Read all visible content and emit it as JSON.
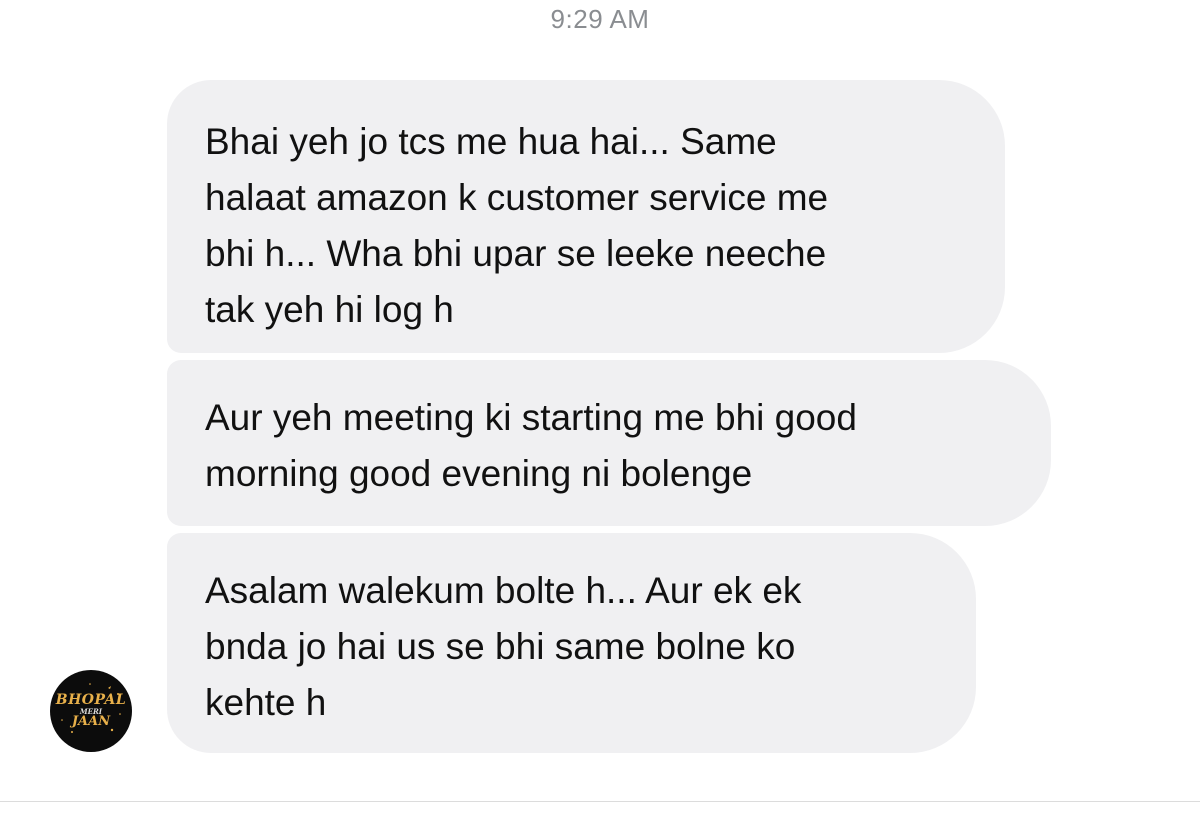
{
  "conversation": {
    "timestamp": "9:29 AM",
    "messages": [
      {
        "text": "Bhai yeh jo tcs me hua hai... Same\nhalaat amazon k customer service me\nbhi h... Wha bhi upar se leeke neeche\ntak yeh hi log h"
      },
      {
        "text": "Aur yeh meeting ki starting me bhi good\nmorning good evening ni bolenge"
      },
      {
        "text": "Asalam walekum bolte h... Aur ek ek\nbnda jo hai us se bhi same bolne ko\nkehte h"
      }
    ],
    "sender_avatar": {
      "line1": "BHOPAL",
      "line2": "MERI",
      "line3": "JAAN"
    }
  },
  "colors": {
    "bubble_background": "#f0f0f2",
    "avatar_background": "#0c0c0c",
    "avatar_accent": "#e8b04a",
    "timestamp_text": "#8a8d91"
  }
}
